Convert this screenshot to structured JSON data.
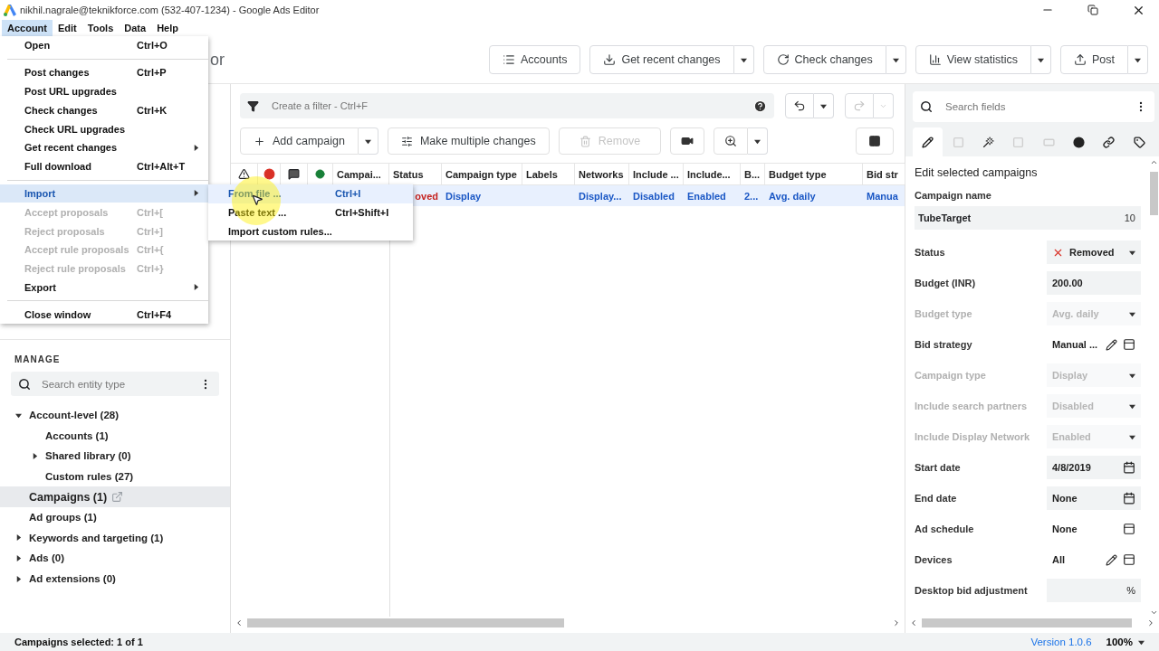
{
  "window": {
    "title": "nikhil.nagrale@teknikforce.com (532-407-1234) - Google Ads Editor"
  },
  "menu_bar": [
    {
      "label": "Account",
      "selected": true
    },
    {
      "label": "Edit",
      "selected": false
    },
    {
      "label": "Tools",
      "selected": false
    },
    {
      "label": "Data",
      "selected": false
    },
    {
      "label": "Help",
      "selected": false
    }
  ],
  "account_menu": [
    {
      "kind": "item",
      "label": "Open",
      "shortcut": "Ctrl+O",
      "disabled": false,
      "selected": false,
      "submenu": false
    },
    {
      "kind": "separator"
    },
    {
      "kind": "item",
      "label": "Post changes",
      "shortcut": "Ctrl+P",
      "disabled": false,
      "selected": false,
      "submenu": false
    },
    {
      "kind": "item",
      "label": "Post URL upgrades",
      "disabled": false,
      "selected": false,
      "submenu": false
    },
    {
      "kind": "item",
      "label": "Check changes",
      "shortcut": "Ctrl+K",
      "disabled": false,
      "selected": false,
      "submenu": false
    },
    {
      "kind": "item",
      "label": "Check URL upgrades",
      "disabled": false,
      "selected": false,
      "submenu": false
    },
    {
      "kind": "item",
      "label": "Get recent changes",
      "disabled": false,
      "selected": false,
      "submenu": true
    },
    {
      "kind": "item",
      "label": "Full download",
      "shortcut": "Ctrl+Alt+T",
      "disabled": false,
      "selected": false,
      "submenu": false
    },
    {
      "kind": "separator"
    },
    {
      "kind": "item",
      "label": "Import",
      "disabled": false,
      "selected": true,
      "submenu": true
    },
    {
      "kind": "item",
      "label": "Accept proposals",
      "shortcut": "Ctrl+[",
      "disabled": true,
      "selected": false,
      "submenu": false
    },
    {
      "kind": "item",
      "label": "Reject proposals",
      "shortcut": "Ctrl+]",
      "disabled": true,
      "selected": false,
      "submenu": false
    },
    {
      "kind": "item",
      "label": "Accept rule proposals",
      "shortcut": "Ctrl+{",
      "disabled": true,
      "selected": false,
      "submenu": false
    },
    {
      "kind": "item",
      "label": "Reject rule proposals",
      "shortcut": "Ctrl+}",
      "disabled": true,
      "selected": false,
      "submenu": false
    },
    {
      "kind": "item",
      "label": "Export",
      "disabled": false,
      "selected": false,
      "submenu": true
    },
    {
      "kind": "separator"
    },
    {
      "kind": "item",
      "label": "Close window",
      "shortcut": "Ctrl+F4",
      "disabled": false,
      "selected": false,
      "submenu": false
    }
  ],
  "import_submenu": [
    {
      "label": "From file ...",
      "shortcut": "Ctrl+I",
      "selected": true
    },
    {
      "label": "Paste text ...",
      "shortcut": "Ctrl+Shift+I",
      "selected": false
    },
    {
      "label": "Import custom rules...",
      "selected": false
    }
  ],
  "app_name_fragment": "or",
  "toolbar": [
    {
      "label": "Accounts",
      "dropdown": false
    },
    {
      "label": "Get recent changes",
      "dropdown": true
    },
    {
      "label": "Check changes",
      "dropdown": true
    },
    {
      "label": "View statistics",
      "dropdown": true
    },
    {
      "label": "Post",
      "dropdown": true
    }
  ],
  "filter": {
    "placeholder": "Create a filter - Ctrl+F",
    "redo_disabled": true
  },
  "grid_toolbar": {
    "add": "Add campaign",
    "multi": "Make multiple changes",
    "remove": {
      "label": "Remove",
      "disabled": true
    }
  },
  "table": {
    "columns": [
      "Campai...",
      "Status",
      "Campaign type",
      "Labels",
      "Networks",
      "Include ...",
      "Include...",
      "B...",
      "Budget type",
      "Bid str"
    ],
    "rows": [
      {
        "selected": true,
        "cells": [
          null,
          {
            "text": "oved",
            "kind": "status"
          },
          {
            "text": "Display",
            "kind": "value"
          },
          null,
          {
            "text": "Display...",
            "kind": "value"
          },
          {
            "text": "Disabled",
            "kind": "value"
          },
          {
            "text": "Enabled",
            "kind": "value"
          },
          {
            "text": "2...",
            "kind": "value"
          },
          {
            "text": "Avg. daily",
            "kind": "value"
          },
          {
            "text": "Manua",
            "kind": "value"
          }
        ]
      }
    ]
  },
  "manage": {
    "title": "MANAGE",
    "search_placeholder": "Search entity type",
    "tree": [
      {
        "label": "Account-level (28)",
        "expanded": true,
        "selected": false,
        "children": [
          {
            "label": "Accounts (1)",
            "selected": false
          },
          {
            "label": "Shared library (0)",
            "expanded": false,
            "selected": false
          },
          {
            "label": "Custom rules (27)",
            "selected": false
          }
        ]
      },
      {
        "label": "Campaigns (1)",
        "selected": true
      },
      {
        "label": "Ad groups (1)",
        "selected": false
      },
      {
        "label": "Keywords and targeting (1)",
        "expanded": false,
        "selected": false
      },
      {
        "label": "Ads (0)",
        "expanded": false,
        "selected": false
      },
      {
        "label": "Ad extensions (0)",
        "expanded": false,
        "selected": false
      }
    ]
  },
  "edit_panel": {
    "search_placeholder": "Search fields",
    "tabs": [
      {
        "selected": true,
        "disabled": false
      },
      {
        "selected": false,
        "disabled": true
      },
      {
        "selected": false,
        "disabled": false
      },
      {
        "selected": false,
        "disabled": true
      },
      {
        "selected": false,
        "disabled": true
      },
      {
        "selected": false,
        "disabled": false
      },
      {
        "selected": false,
        "disabled": false
      },
      {
        "selected": false,
        "disabled": false
      }
    ],
    "heading": "Edit selected campaigns",
    "fields": [
      {
        "kind": "name",
        "label": "Campaign name",
        "value": "TubeTarget",
        "counter": "10"
      },
      {
        "kind": "select",
        "label": "Status",
        "value": "Removed",
        "disabled": false,
        "removed": true
      },
      {
        "kind": "input",
        "label": "Budget (INR)",
        "value": "200.00",
        "disabled": false
      },
      {
        "kind": "select",
        "label": "Budget type",
        "value": "Avg. daily",
        "disabled": true
      },
      {
        "kind": "action",
        "label": "Bid strategy",
        "value": "Manual ...",
        "editable": true
      },
      {
        "kind": "select",
        "label": "Campaign type",
        "value": "Display",
        "disabled": true
      },
      {
        "kind": "select",
        "label": "Include search partners",
        "value": "Disabled",
        "disabled": true
      },
      {
        "kind": "select",
        "label": "Include Display Network",
        "value": "Enabled",
        "disabled": true
      },
      {
        "kind": "date",
        "label": "Start date",
        "value": "4/8/2019"
      },
      {
        "kind": "date",
        "label": "End date",
        "value": "None"
      },
      {
        "kind": "action",
        "label": "Ad schedule",
        "value": "None",
        "editable": false
      },
      {
        "kind": "action",
        "label": "Devices",
        "value": "All",
        "editable": true
      },
      {
        "kind": "input",
        "label": "Desktop bid adjustment",
        "suffix": "%",
        "disabled": false
      }
    ]
  },
  "status_bar": {
    "selection": "Campaigns selected: 1 of 1",
    "version": "Version 1.0.6",
    "zoom": "100%"
  }
}
